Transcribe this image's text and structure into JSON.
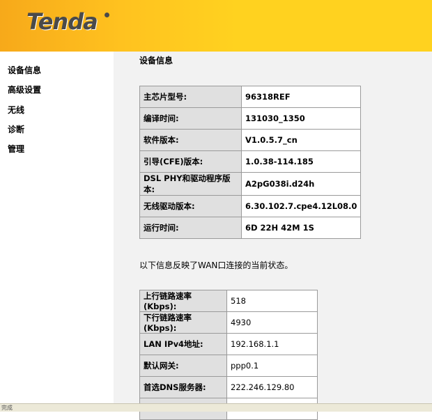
{
  "header": {
    "logo": "Tenda"
  },
  "sidebar": {
    "items": [
      {
        "label": "设备信息"
      },
      {
        "label": "高级设置"
      },
      {
        "label": "无线"
      },
      {
        "label": "诊断"
      },
      {
        "label": "管理"
      }
    ]
  },
  "main": {
    "title": "设备信息",
    "device_info": [
      {
        "key": "主芯片型号:",
        "value": "96318REF"
      },
      {
        "key": "编译时间:",
        "value": "131030_1350"
      },
      {
        "key": "软件版本:",
        "value": "V1.0.5.7_cn"
      },
      {
        "key": "引导(CFE)版本:",
        "value": "1.0.38-114.185"
      },
      {
        "key": "DSL PHY和驱动程序版本:",
        "value": "A2pG038i.d24h"
      },
      {
        "key": "无线驱动版本:",
        "value": "6.30.102.7.cpe4.12L08.0"
      },
      {
        "key": "运行时间:",
        "value": "6D 22H 42M 1S"
      }
    ],
    "wan_note": "以下信息反映了WAN口连接的当前状态。",
    "wan_info": [
      {
        "key": "上行链路速率(Kbps):",
        "value": "518"
      },
      {
        "key": "下行链路速率(Kbps):",
        "value": "4930"
      },
      {
        "key": "LAN IPv4地址:",
        "value": "192.168.1.1"
      },
      {
        "key": "默认网关:",
        "value": "ppp0.1"
      },
      {
        "key": "首选DNS服务器:",
        "value": "222.246.129.80"
      },
      {
        "key": "",
        "value": ""
      }
    ]
  },
  "statusbar": {
    "text": "完成"
  }
}
